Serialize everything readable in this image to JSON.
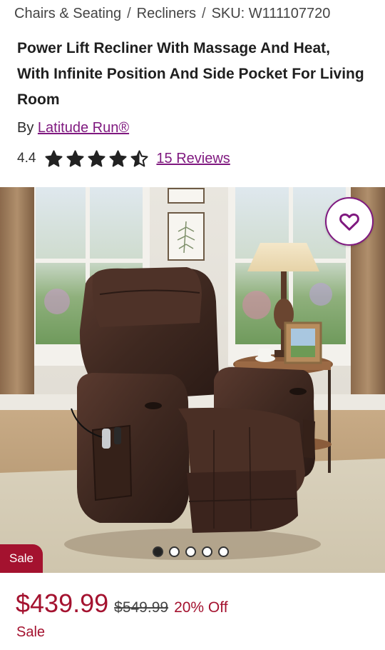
{
  "breadcrumb": {
    "items": [
      "Chairs & Seating",
      "Recliners",
      "SKU: W111107720"
    ],
    "separator": "/"
  },
  "product": {
    "title": "Power Lift Recliner With Massage And Heat, With Infinite Position And Side Pocket For Living Room",
    "by_prefix": "By",
    "brand": "Latitude Run®",
    "rating": "4.4",
    "rating_value": 4.4,
    "rating_max": 5,
    "reviews_link": "15 Reviews"
  },
  "gallery": {
    "image_count": 5,
    "active_index": 0,
    "favorite_icon": "heart-outline-icon",
    "badge": "Sale"
  },
  "pricing": {
    "price": "$439.99",
    "original_price": "$549.99",
    "discount": "20% Off",
    "sale_label": "Sale"
  },
  "colors": {
    "accent_purple": "#7f187f",
    "sale_red": "#a4122f"
  }
}
